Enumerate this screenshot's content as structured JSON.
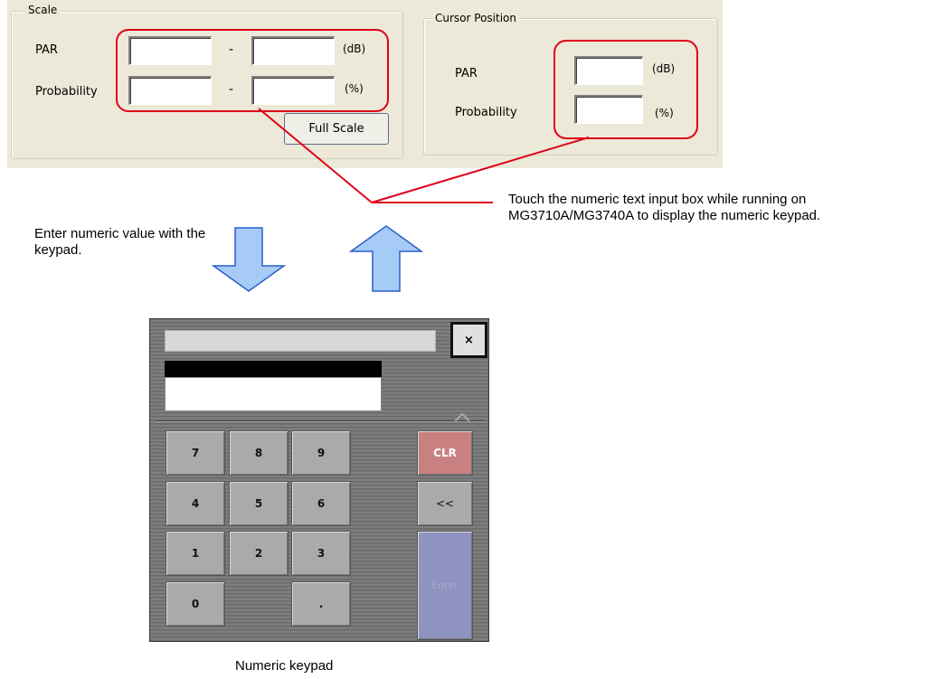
{
  "scale": {
    "legend": "Scale",
    "par_label": "PAR",
    "probability_label": "Probability",
    "dash": "-",
    "par_unit": "(dB)",
    "probability_unit": "(%)",
    "par_min": "",
    "par_max": "",
    "probability_min": "",
    "probability_max": "",
    "full_scale_label": "Full Scale"
  },
  "cursor_position": {
    "legend": "Cursor Position",
    "par_label": "PAR",
    "probability_label": "Probability",
    "par_unit": "(dB)",
    "probability_unit": "(%)",
    "par_value": "",
    "probability_value": ""
  },
  "captions": {
    "enter_numeric": "Enter numeric value with the keypad.",
    "touch_note": "Touch the numeric text input box while running on MG3710A/MG3740A to display the numeric keypad.",
    "keypad_title": "Numeric keypad"
  },
  "keypad": {
    "close": "×",
    "display_value": "",
    "keys": {
      "k7": "7",
      "k8": "8",
      "k9": "9",
      "k4": "4",
      "k5": "5",
      "k6": "6",
      "k1": "1",
      "k2": "2",
      "k3": "3",
      "k0": "0",
      "dot": ".",
      "clr": "CLR",
      "backspace": "<<",
      "enter": "Enter"
    }
  },
  "colors": {
    "highlight": "#e0001a",
    "arrow_fill": "#a6cbf7",
    "arrow_stroke": "#2b5ec8",
    "clr_key": "#c98080",
    "enter_key": "#8e93bf"
  }
}
